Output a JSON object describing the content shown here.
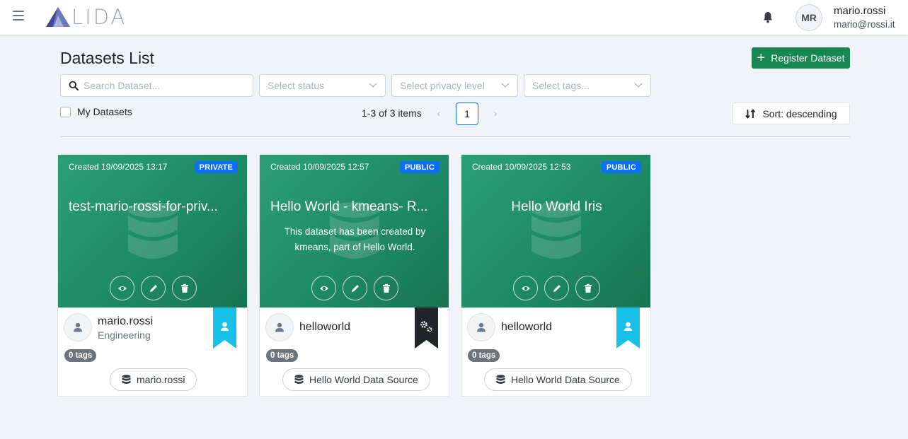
{
  "app": {
    "logo_text": "LIDA"
  },
  "user": {
    "initials": "MR",
    "name": "mario.rossi",
    "email": "mario@rossi.it"
  },
  "page": {
    "title": "Datasets List",
    "register_label": "Register Dataset"
  },
  "filters": {
    "search_placeholder": "Search Dataset...",
    "status_placeholder": "Select status",
    "privacy_placeholder": "Select privacy level",
    "tags_placeholder": "Select tags...",
    "my_datasets_label": "My Datasets"
  },
  "pagination": {
    "summary": "1-3 of 3 items",
    "current_page": "1",
    "prev": "‹",
    "next": "›"
  },
  "sort": {
    "label": "Sort: descending"
  },
  "colors": {
    "primary_green": "#198754",
    "card_green": "#1f8a66",
    "badge_blue": "#0d6efd",
    "ribbon_cyan": "#17c1e8",
    "ribbon_dark": "#212529"
  },
  "cards": [
    {
      "created": "Created 19/09/2025 13:17",
      "privacy": "PRIVATE",
      "title": "test-mario-rossi-for-priv...",
      "description": "",
      "owner": "mario.rossi",
      "department": "Engineering",
      "ribbon_icon": "user-icon",
      "tags": "0 tags",
      "source": "mario.rossi"
    },
    {
      "created": "Created 10/09/2025 12:57",
      "privacy": "PUBLIC",
      "title": "Hello World - kmeans- R...",
      "description": "This dataset has been created by kmeans, part of Hello World.",
      "owner": "helloworld",
      "department": "",
      "ribbon_icon": "gears-icon",
      "tags": "0 tags",
      "source": "Hello World Data Source"
    },
    {
      "created": "Created 10/09/2025 12:53",
      "privacy": "PUBLIC",
      "title": "Hello World Iris",
      "description": "",
      "owner": "helloworld",
      "department": "",
      "ribbon_icon": "user-icon",
      "tags": "0 tags",
      "source": "Hello World Data Source"
    }
  ]
}
